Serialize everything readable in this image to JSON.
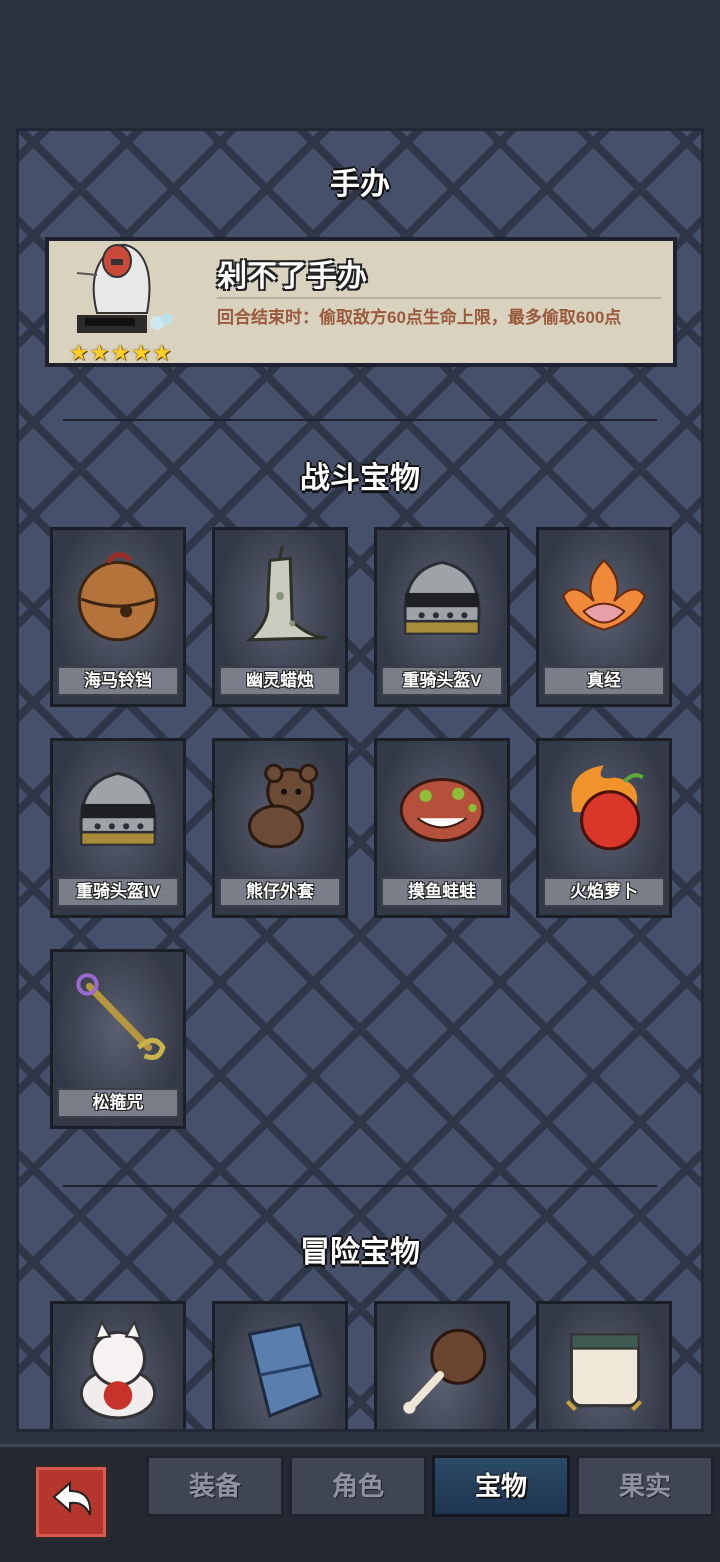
{
  "header": {
    "title": "手办"
  },
  "featured": {
    "name": "剁不了手办",
    "description": "回合结束时：偷取敌方60点生命上限，最多偷取600点",
    "stars": 5
  },
  "sections": [
    {
      "title": "战斗宝物",
      "items": [
        {
          "label": "海马铃铛",
          "icon": "bell-icon"
        },
        {
          "label": "幽灵蜡烛",
          "icon": "ghost-candle-icon"
        },
        {
          "label": "重骑头盔V",
          "icon": "knight-helmet-icon"
        },
        {
          "label": "真经",
          "icon": "lotus-flame-icon"
        },
        {
          "label": "重骑头盔IV",
          "icon": "knight-helmet-icon"
        },
        {
          "label": "熊仔外套",
          "icon": "teddy-bear-icon"
        },
        {
          "label": "摸鱼蛙蛙",
          "icon": "frog-creature-icon"
        },
        {
          "label": "火焰萝卜",
          "icon": "fire-radish-icon"
        },
        {
          "label": "松箍咒",
          "icon": "golden-staff-icon"
        }
      ]
    },
    {
      "title": "冒险宝物",
      "items": [
        {
          "label": "",
          "icon": "lucky-cat-icon"
        },
        {
          "label": "",
          "icon": "blue-cloak-icon"
        },
        {
          "label": "",
          "icon": "meat-drumstick-icon"
        },
        {
          "label": "",
          "icon": "pillow-icon"
        }
      ]
    }
  ],
  "tabs": [
    {
      "label": "装备",
      "active": false
    },
    {
      "label": "角色",
      "active": false
    },
    {
      "label": "宝物",
      "active": true
    },
    {
      "label": "果实",
      "active": false
    }
  ]
}
